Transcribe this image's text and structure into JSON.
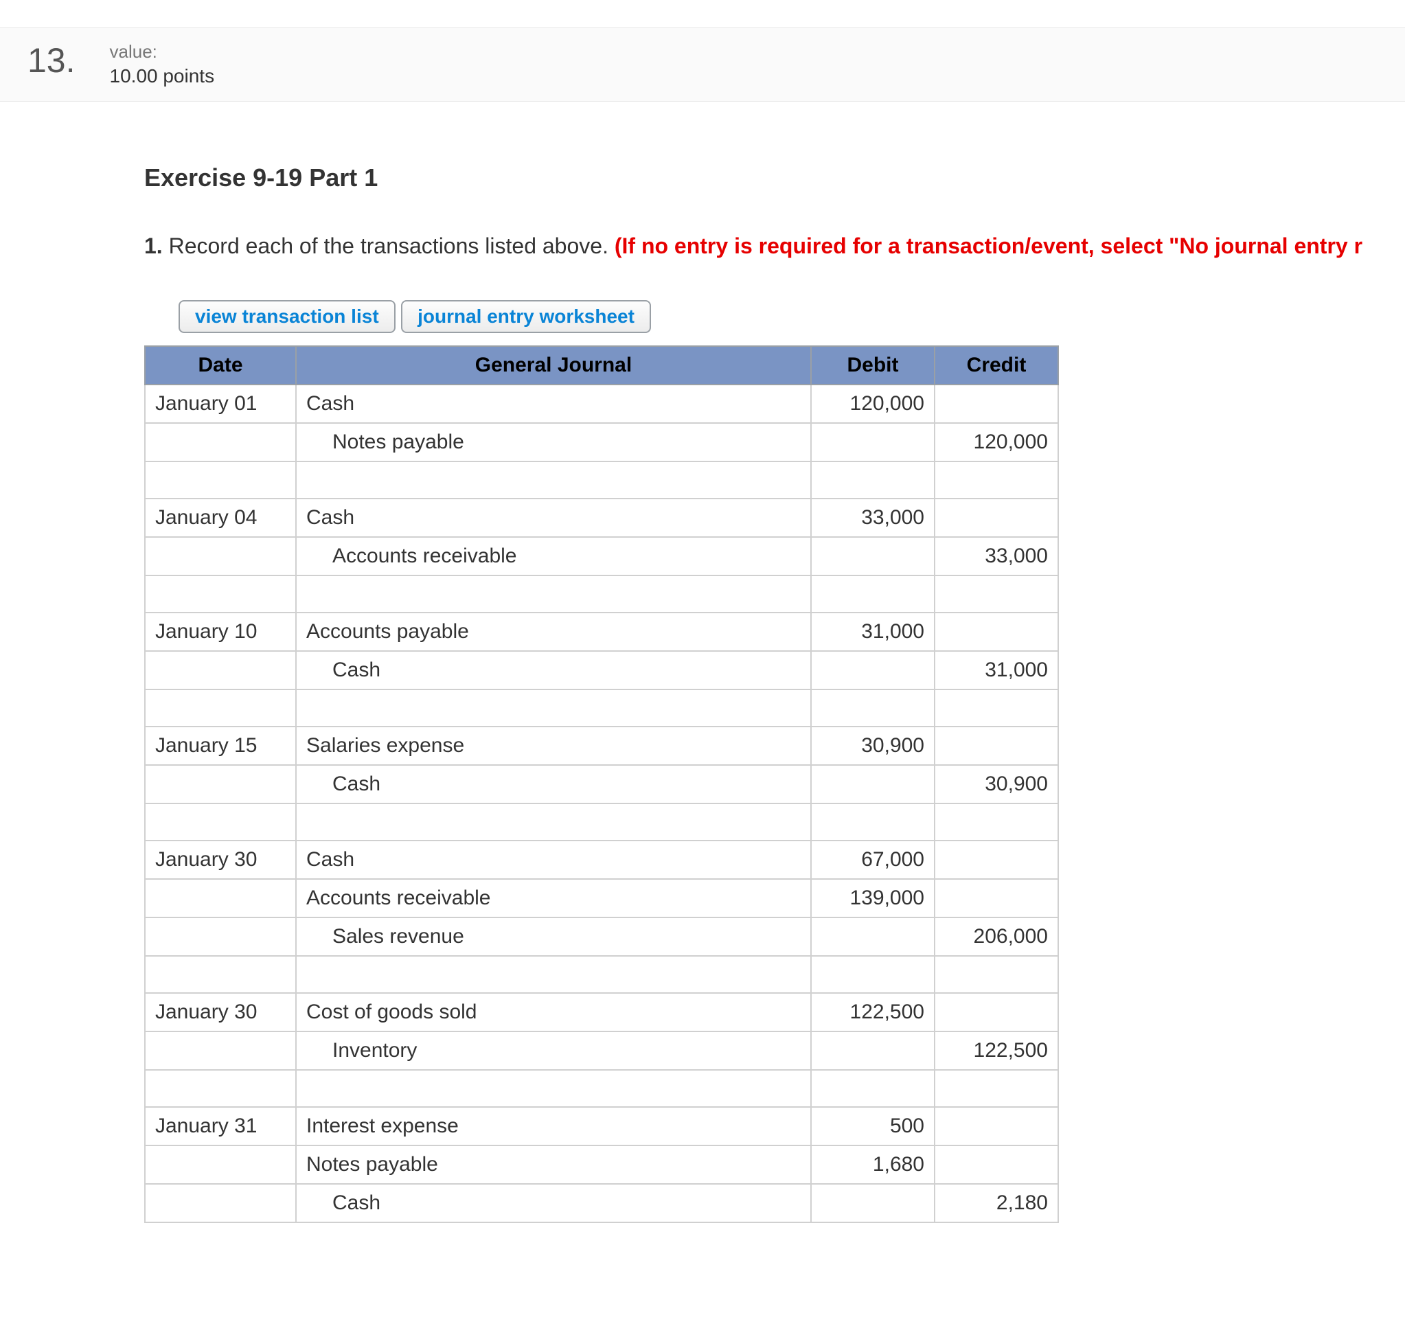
{
  "question_number": "13.",
  "value_label": "value:",
  "points": "10.00 points",
  "exercise_title": "Exercise 9-19 Part 1",
  "instruction_number": "1.",
  "instruction_text": " Record each of the transactions listed above. ",
  "instruction_warning": "(If no entry is required for a transaction/event, select \"No journal entry r",
  "tabs": {
    "view_list": "view transaction list",
    "worksheet": "journal entry worksheet"
  },
  "headers": {
    "date": "Date",
    "journal": "General Journal",
    "debit": "Debit",
    "credit": "Credit"
  },
  "rows": [
    {
      "date": "January 01",
      "account": "Cash",
      "indent": false,
      "debit": "120,000",
      "credit": ""
    },
    {
      "date": "",
      "account": "Notes payable",
      "indent": true,
      "debit": "",
      "credit": "120,000"
    },
    {
      "date": "",
      "account": "",
      "indent": false,
      "debit": "",
      "credit": ""
    },
    {
      "date": "January 04",
      "account": "Cash",
      "indent": false,
      "debit": "33,000",
      "credit": ""
    },
    {
      "date": "",
      "account": "Accounts receivable",
      "indent": true,
      "debit": "",
      "credit": "33,000"
    },
    {
      "date": "",
      "account": "",
      "indent": false,
      "debit": "",
      "credit": ""
    },
    {
      "date": "January 10",
      "account": "Accounts payable",
      "indent": false,
      "debit": "31,000",
      "credit": ""
    },
    {
      "date": "",
      "account": "Cash",
      "indent": true,
      "debit": "",
      "credit": "31,000"
    },
    {
      "date": "",
      "account": "",
      "indent": false,
      "debit": "",
      "credit": ""
    },
    {
      "date": "January 15",
      "account": "Salaries expense",
      "indent": false,
      "debit": "30,900",
      "credit": ""
    },
    {
      "date": "",
      "account": "Cash",
      "indent": true,
      "debit": "",
      "credit": "30,900"
    },
    {
      "date": "",
      "account": "",
      "indent": false,
      "debit": "",
      "credit": ""
    },
    {
      "date": "January 30",
      "account": "Cash",
      "indent": false,
      "debit": "67,000",
      "credit": ""
    },
    {
      "date": "",
      "account": "Accounts receivable",
      "indent": false,
      "debit": "139,000",
      "credit": ""
    },
    {
      "date": "",
      "account": "Sales revenue",
      "indent": true,
      "debit": "",
      "credit": "206,000"
    },
    {
      "date": "",
      "account": "",
      "indent": false,
      "debit": "",
      "credit": ""
    },
    {
      "date": "January 30",
      "account": "Cost of goods sold",
      "indent": false,
      "debit": "122,500",
      "credit": ""
    },
    {
      "date": "",
      "account": "Inventory",
      "indent": true,
      "debit": "",
      "credit": "122,500"
    },
    {
      "date": "",
      "account": "",
      "indent": false,
      "debit": "",
      "credit": ""
    },
    {
      "date": "January 31",
      "account": "Interest expense",
      "indent": false,
      "debit": "500",
      "credit": ""
    },
    {
      "date": "",
      "account": "Notes payable",
      "indent": false,
      "debit": "1,680",
      "credit": ""
    },
    {
      "date": "",
      "account": "Cash",
      "indent": true,
      "debit": "",
      "credit": "2,180"
    }
  ]
}
